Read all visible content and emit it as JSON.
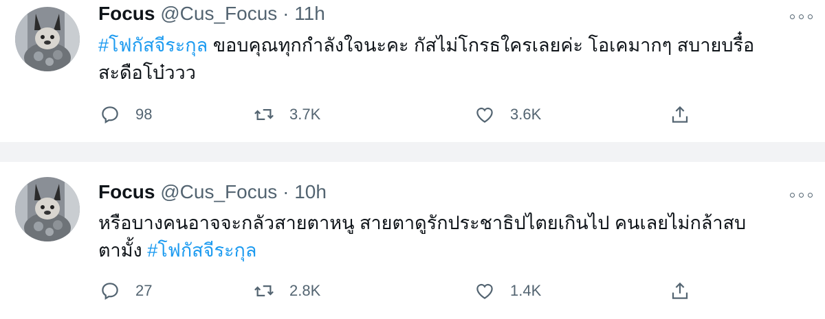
{
  "tweets": [
    {
      "name": "Focus",
      "handle": "@Cus_Focus",
      "separator": "·",
      "time": "11h",
      "hashtag_lead": "#โฟกัสจีระกุล",
      "text_line1": " ขอบคุณทุกกำลังใจนะคะ กัสไม่โกรธใครเลยค่ะ โอเคมากๆ สบายบรื๋อ",
      "text_line2": "สะดือโบ๋ววว",
      "replies": "98",
      "retweets": "3.7K",
      "likes": "3.6K"
    },
    {
      "name": "Focus",
      "handle": "@Cus_Focus",
      "separator": "·",
      "time": "10h",
      "text_line1": "หรือบางคนอาจจะกลัวสายตาหนู สายตาดูรักประชาธิปไตยเกินไป คนเลยไม่กล้าสบ",
      "text_line2_prefix": "ตามั้ง ",
      "hashtag_trail": "#โฟกัสจีระกุล",
      "replies": "27",
      "retweets": "2.8K",
      "likes": "1.4K"
    }
  ],
  "icons": {
    "reply": "reply-icon",
    "retweet": "retweet-icon",
    "like": "heart-icon",
    "share": "share-icon",
    "more": "more-icon"
  },
  "colors": {
    "link": "#1d9bf0",
    "muted": "#536471",
    "text": "#0f1419",
    "divider": "#f2f3f5"
  }
}
